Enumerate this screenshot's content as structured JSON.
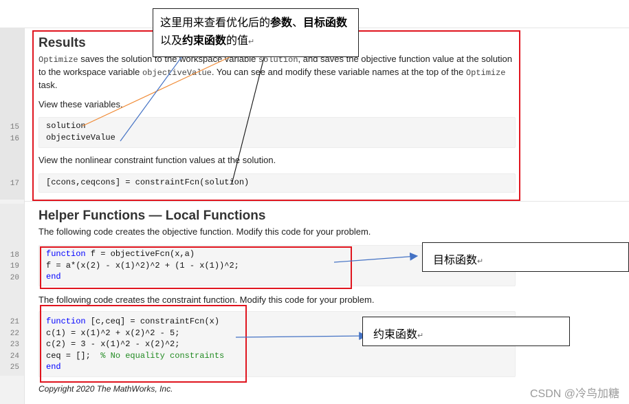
{
  "colors": {
    "highlight_box": "#e0141e",
    "keyword": "#0000ff",
    "comment": "#228b22",
    "arrow_orange": "#f08a34",
    "arrow_blue": "#4472c4"
  },
  "results": {
    "heading": "Results",
    "p1_code1": "Optimize",
    "p1_text1": " saves the solution to the workspace variable ",
    "p1_code2": "solution",
    "p1_text2": ", and saves the objective function value at the solution to the workspace variable ",
    "p1_code3": "objectiveValue",
    "p1_text3": ". You can see and modify these variable names at the top of the ",
    "p1_code4": "Optimize",
    "p1_text4": " task.",
    "view_vars": "View these variables.",
    "code1": {
      "lines": [
        "15",
        "16"
      ],
      "line15": "solution",
      "line16": "objectiveValue"
    },
    "view_nonlinear": "View the nonlinear constraint function values at the solution.",
    "code2": {
      "lines": [
        "17"
      ],
      "line17": "[ccons,ceqcons] = constraintFcn(solution)"
    }
  },
  "helpers": {
    "heading": "Helper Functions — Local Functions",
    "obj_desc": "The following code creates the objective function. Modify this code for your problem.",
    "obj_code": {
      "line_numbers": [
        "18",
        "19",
        "20"
      ],
      "l1_kw": "function",
      "l1_rest": " f = objectiveFcn(x,a)",
      "l2": "f = a*(x(2) - x(1)^2)^2 + (1 - x(1))^2;",
      "l3_kw": "end"
    },
    "con_desc": "The following code creates the constraint function. Modify this code for your problem.",
    "con_code": {
      "line_numbers": [
        "21",
        "22",
        "23",
        "24",
        "25"
      ],
      "l1_kw": "function",
      "l1_rest": " [c,ceq] = constraintFcn(x)",
      "l2": "c(1) = x(1)^2 + x(2)^2 - 5;",
      "l3": "c(2) = 3 - x(1)^2 - x(2)^2;",
      "l4_code": "ceq = [];  ",
      "l4_comment": "% No equality constraints",
      "l5_kw": "end"
    }
  },
  "footer": "Copyright 2020 The MathWorks, Inc.",
  "annotations": {
    "top_note": {
      "part1": "这里用来查看优化后的",
      "bold1": "参数",
      "part2": "、",
      "bold2": "目标函数",
      "part3": "以及",
      "bold3": "约束函数",
      "part4": "的值",
      "return_mark": "↵"
    },
    "objective_note": "目标函数",
    "constraint_note": "约束函数",
    "return_mark": "↵"
  },
  "watermark": "CSDN @冷鸟加糖"
}
